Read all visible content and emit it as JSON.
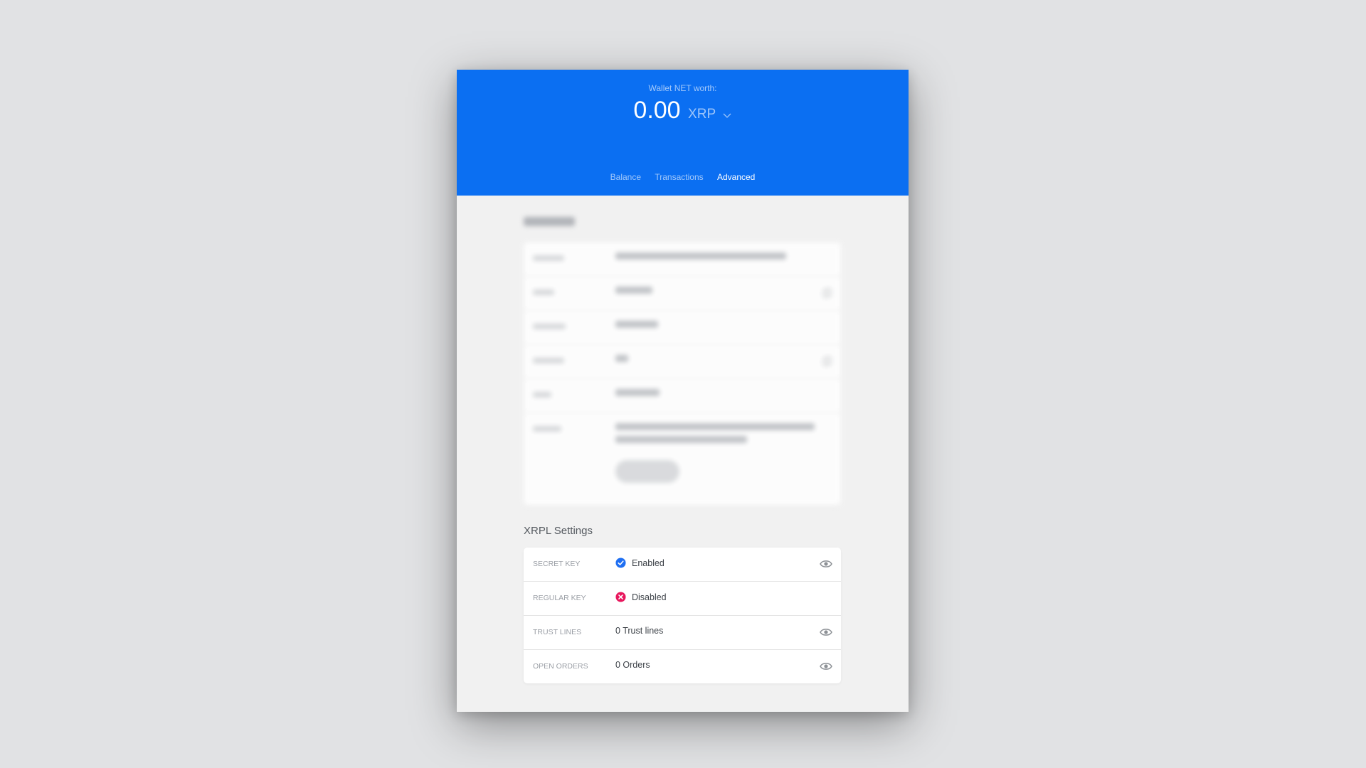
{
  "header": {
    "net_worth_label": "Wallet NET worth:",
    "net_worth_value": "0.00",
    "currency": "XRP",
    "tabs": [
      {
        "label": "Balance",
        "active": false
      },
      {
        "label": "Transactions",
        "active": false
      },
      {
        "label": "Advanced",
        "active": true
      }
    ],
    "brand_color": "#0b6ff2"
  },
  "xrpl_settings": {
    "title": "XRPL Settings",
    "rows": [
      {
        "label": "SECRET KEY",
        "value": "Enabled",
        "status": "enabled",
        "status_icon": "check-circle-icon",
        "action_icon": "eye-icon"
      },
      {
        "label": "REGULAR KEY",
        "value": "Disabled",
        "status": "disabled",
        "status_icon": "x-circle-icon"
      },
      {
        "label": "TRUST LINES",
        "value": "0 Trust lines",
        "action_icon": "eye-icon"
      },
      {
        "label": "OPEN ORDERS",
        "value": "0 Orders",
        "action_icon": "eye-icon"
      }
    ],
    "enabled_color": "#1f6ff2",
    "disabled_color": "#e8175d"
  }
}
